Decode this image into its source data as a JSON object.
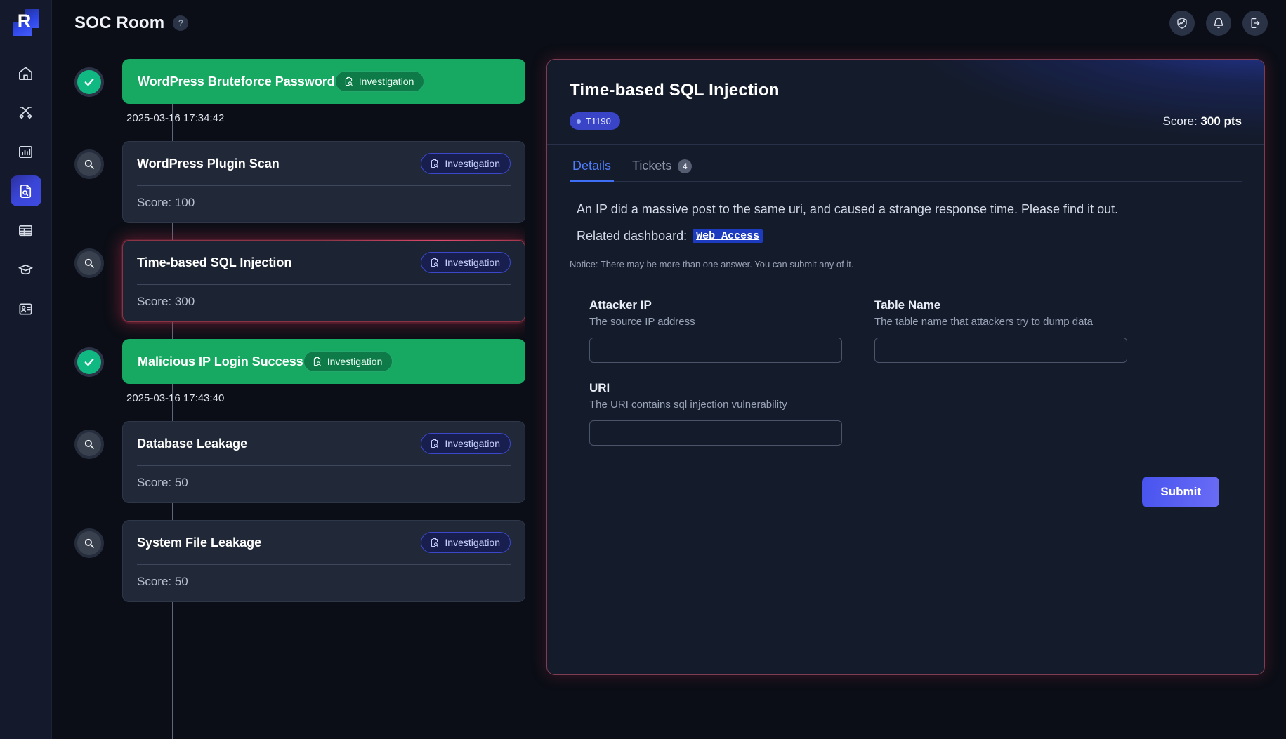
{
  "brand": {
    "logo_letter": "R"
  },
  "sidebar": {
    "items": [
      {
        "icon": "home-icon",
        "name": "home"
      },
      {
        "icon": "crossed-swords-icon",
        "name": "attack"
      },
      {
        "icon": "bar-chart-icon",
        "name": "dashboard"
      },
      {
        "icon": "file-search-icon",
        "name": "investigation",
        "active": true
      },
      {
        "icon": "table-icon",
        "name": "logs"
      },
      {
        "icon": "graduation-cap-icon",
        "name": "learning"
      },
      {
        "icon": "id-badge-icon",
        "name": "profile"
      }
    ]
  },
  "header": {
    "title": "SOC Room",
    "help_label": "?",
    "actions": [
      {
        "icon": "shield-activity-icon",
        "name": "status-button"
      },
      {
        "icon": "bell-icon",
        "name": "notifications-button"
      },
      {
        "icon": "logout-icon",
        "name": "logout-button"
      }
    ]
  },
  "timeline": {
    "entries": [
      {
        "title": "WordPress Bruteforce Password",
        "state": "solved",
        "node": "check",
        "pill": "Investigation",
        "timestamp": "2025-03-16 17:34:42"
      },
      {
        "title": "WordPress Plugin Scan",
        "state": "open",
        "node": "search",
        "pill": "Investigation",
        "score_label": "Score: 100"
      },
      {
        "title": "Time-based SQL Injection",
        "state": "open",
        "selected": true,
        "node": "search",
        "pill": "Investigation",
        "score_label": "Score: 300"
      },
      {
        "title": "Malicious IP Login Success",
        "state": "solved",
        "node": "check",
        "pill": "Investigation",
        "timestamp": "2025-03-16 17:43:40"
      },
      {
        "title": "Database Leakage",
        "state": "open",
        "node": "search",
        "pill": "Investigation",
        "score_label": "Score: 50"
      },
      {
        "title": "System File Leakage",
        "state": "open",
        "node": "search",
        "pill": "Investigation",
        "score_label": "Score: 50"
      }
    ]
  },
  "detail": {
    "title": "Time-based SQL Injection",
    "ttp_badge": "T1190",
    "score_prefix": "Score: ",
    "score_value": "300 pts",
    "tabs": [
      {
        "label": "Details",
        "active": true
      },
      {
        "label": "Tickets",
        "count": "4",
        "active": false
      }
    ],
    "description": "An IP did a massive post to the same uri, and caused a strange response time. Please find it out.",
    "dashboard_label": "Related dashboard:",
    "dashboard_link": "Web_Access",
    "notice": "Notice: There may be more than one answer. You can submit any of it.",
    "fields": [
      {
        "label": "Attacker IP",
        "hint": "The source IP address",
        "value": "",
        "placeholder": ""
      },
      {
        "label": "Table Name",
        "hint": "The table name that attackers try to dump data",
        "value": "",
        "placeholder": ""
      },
      {
        "label": "URI",
        "hint": "The URI contains sql injection vulnerability",
        "value": "",
        "placeholder": ""
      }
    ],
    "submit_label": "Submit"
  },
  "colors": {
    "accent_blue": "#3d6ef5",
    "solved_green": "#17a862",
    "selected_red": "#8b3445",
    "panel_bg": "#141b2b",
    "sidebar_bg": "#141a2b"
  }
}
